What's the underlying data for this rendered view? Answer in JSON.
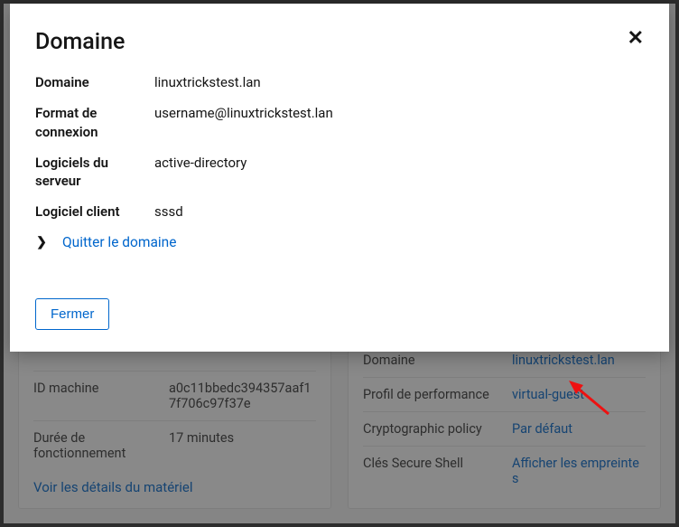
{
  "modal": {
    "title": "Domaine",
    "close_glyph": "✕",
    "rows": {
      "domain_label": "Domaine",
      "domain_value": "linuxtrickstest.lan",
      "login_format_label": "Format de connexion",
      "login_format_value": "username@linuxtrickstest.lan",
      "server_software_label": "Logiciels du serveur",
      "server_software_value": "active-directory",
      "client_software_label": "Logiciel client",
      "client_software_value": "sssd"
    },
    "leave_label": "Quitter le domaine",
    "close_button": "Fermer"
  },
  "bg_left": {
    "machine_id_label": "ID machine",
    "machine_id_value": "a0c11bbedc394357aaf17f706c97f37e",
    "uptime_label": "Durée de fonctionnement",
    "uptime_value": "17 minutes",
    "hw_link": "Voir les détails du matériel"
  },
  "bg_right": {
    "domain_label": "Domaine",
    "domain_value": "linuxtrickstest.lan",
    "perf_label": "Profil de performance",
    "perf_value": "virtual-guest",
    "crypto_label": "Cryptographic policy",
    "crypto_value": "Par défaut",
    "ssh_label": "Clés Secure Shell",
    "ssh_value": "Afficher les empreintes"
  }
}
